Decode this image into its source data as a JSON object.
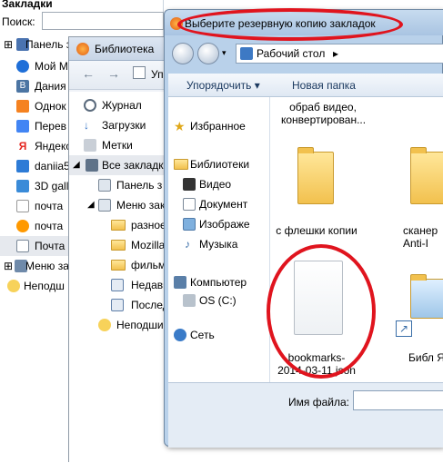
{
  "sidebar": {
    "title": "Закладки",
    "search_label": "Поиск:",
    "items": [
      {
        "label": "Панель з",
        "icon": "bookmarks-toolbar-icon"
      },
      {
        "label": "Мой М",
        "icon": "mail-ru-icon"
      },
      {
        "label": "Дания",
        "icon": "vk-icon"
      },
      {
        "label": "Однок",
        "icon": "odnoklassniki-icon"
      },
      {
        "label": "Перев",
        "icon": "translate-icon"
      },
      {
        "label": "Яндекс",
        "icon": "yandex-icon"
      },
      {
        "label": "daniia5",
        "icon": "user-icon"
      },
      {
        "label": "3D gall",
        "icon": "gallery-icon"
      },
      {
        "label": "почта",
        "icon": "page-icon"
      },
      {
        "label": "почта",
        "icon": "mail-icon"
      },
      {
        "label": "Почта",
        "icon": "envelope-icon"
      },
      {
        "label": "Меню за",
        "icon": "menu-icon"
      },
      {
        "label": "Неподш",
        "icon": "unsorted-icon"
      }
    ]
  },
  "library": {
    "title": "Библиотека",
    "organize_partial": "Уп",
    "tree": [
      {
        "label": "Журнал",
        "icon": "history-icon"
      },
      {
        "label": "Загрузки",
        "icon": "downloads-icon"
      },
      {
        "label": "Метки",
        "icon": "tags-icon"
      },
      {
        "label": "Все закладк",
        "icon": "all-bookmarks-icon"
      },
      {
        "label": "Панель з",
        "icon": "toolbar-icon"
      },
      {
        "label": "Меню зак",
        "icon": "menu-icon"
      },
      {
        "label": "разное",
        "icon": "folder-icon"
      },
      {
        "label": "Mozilla",
        "icon": "folder-icon"
      },
      {
        "label": "фильм",
        "icon": "folder-icon"
      },
      {
        "label": "Недавн",
        "icon": "query-icon"
      },
      {
        "label": "Послед",
        "icon": "query-icon"
      },
      {
        "label": "Неподши",
        "icon": "unsorted-icon"
      }
    ]
  },
  "dialog": {
    "title": "Выберите резервную копию закладок",
    "address": "Рабочий стол",
    "address_arrow": "▸",
    "organize_label": "Упорядочить",
    "organize_arrow": "▾",
    "new_folder_label": "Новая папка",
    "nav": [
      {
        "label": "Избранное",
        "icon": "favorites-star-icon"
      },
      {
        "label": "Библиотеки",
        "icon": "libraries-icon"
      },
      {
        "label": "Видео",
        "icon": "video-icon"
      },
      {
        "label": "Документ",
        "icon": "documents-icon"
      },
      {
        "label": "Изображе",
        "icon": "pictures-icon"
      },
      {
        "label": "Музыка",
        "icon": "music-icon"
      },
      {
        "label": "Компьютер",
        "icon": "computer-icon"
      },
      {
        "label": "OS (C:)",
        "icon": "drive-icon"
      },
      {
        "label": "Сеть",
        "icon": "network-icon"
      }
    ],
    "files_top_text": "обраб видео, конвертирован...",
    "files": [
      {
        "name": "с флешки копии",
        "icon": "folder-icon"
      },
      {
        "name": "сканер Anti-I",
        "icon": "folder-icon"
      },
      {
        "name": "bookmarks-2014-03-11.json",
        "icon": "file-icon"
      },
      {
        "name": "Библ Я",
        "icon": "library-shortcut-icon"
      }
    ],
    "filename_label": "Имя файла:",
    "filename_value": ""
  },
  "colors": {
    "highlight": "#e0141e",
    "dialog_frame": "#b9d1ea",
    "folder": "#f2c14e"
  }
}
